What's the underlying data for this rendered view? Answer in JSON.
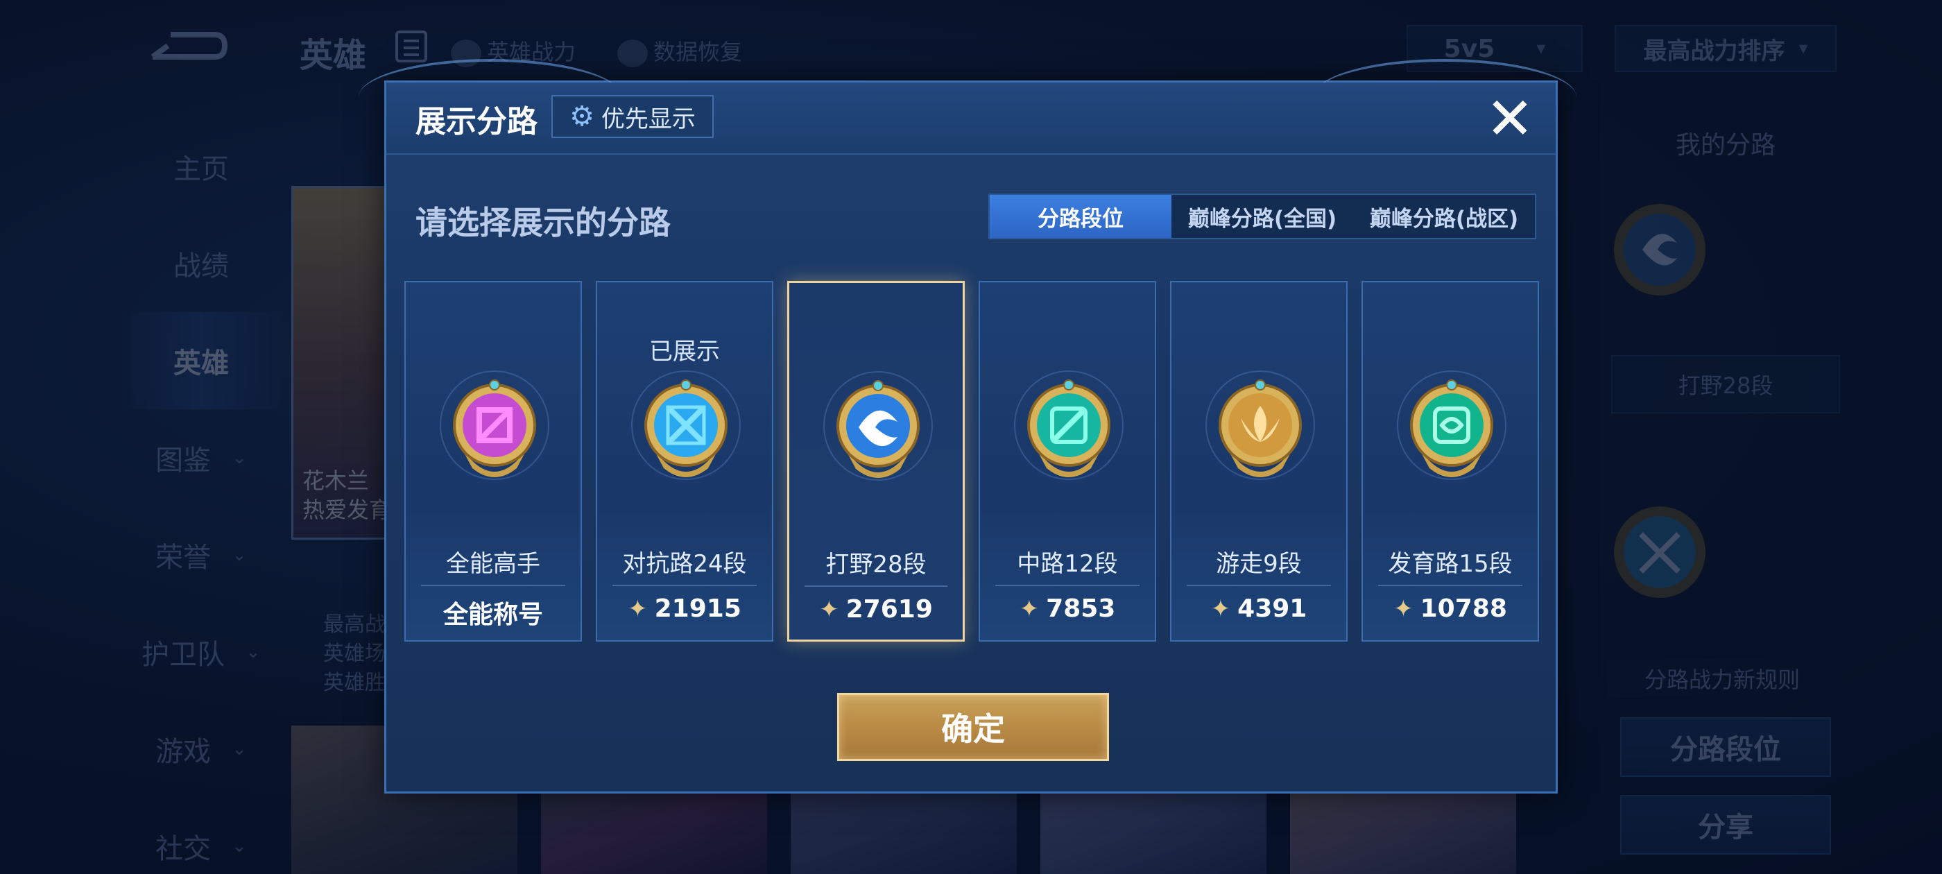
{
  "background": {
    "title": "英雄",
    "links": [
      "英雄战力",
      "数据恢复"
    ],
    "mode_select": "5v5",
    "sort_select": "最高战力排序",
    "sidebar": [
      {
        "label": "主页",
        "active": false,
        "chevron": false
      },
      {
        "label": "战绩",
        "active": false,
        "chevron": false
      },
      {
        "label": "英雄",
        "active": true,
        "chevron": false
      },
      {
        "label": "图鉴",
        "active": false,
        "chevron": true
      },
      {
        "label": "荣誉",
        "active": false,
        "chevron": true
      },
      {
        "label": "护卫队",
        "active": false,
        "chevron": true
      },
      {
        "label": "游戏",
        "active": false,
        "chevron": true
      },
      {
        "label": "社交",
        "active": false,
        "chevron": true
      }
    ],
    "hero_card_text": [
      "花木兰",
      "热爱发育"
    ],
    "hero_stats": [
      "最高战",
      "英雄场",
      "英雄胜"
    ],
    "right_panel": {
      "title": "我的分路",
      "lane_label": "打野28段",
      "rule_text": "分路战力新规则",
      "lane_button": "分路段位",
      "share_button": "分享"
    }
  },
  "modal": {
    "title": "展示分路",
    "priority_button": "优先显示",
    "subtitle": "请选择展示的分路",
    "tabs": [
      {
        "label": "分路段位",
        "active": true
      },
      {
        "label": "巅峰分路(全国)",
        "active": false
      },
      {
        "label": "巅峰分路(战区)",
        "active": false
      }
    ],
    "cards": [
      {
        "id": "all",
        "name": "全能高手",
        "value": "全能称号",
        "show_power_icon": false,
        "shown_text": "",
        "selected": false,
        "color": "#c54bd0",
        "inner": "#ff8cff"
      },
      {
        "id": "top",
        "name": "对抗路24段",
        "value": "21915",
        "show_power_icon": true,
        "shown_text": "已展示",
        "selected": false,
        "color": "#2aa8f0",
        "inner": "#7fe2ff"
      },
      {
        "id": "jungle",
        "name": "打野28段",
        "value": "27619",
        "show_power_icon": true,
        "shown_text": "",
        "selected": true,
        "color": "#2b7fe0",
        "inner": "#ffffff"
      },
      {
        "id": "mid",
        "name": "中路12段",
        "value": "7853",
        "show_power_icon": true,
        "shown_text": "",
        "selected": false,
        "color": "#17b6a0",
        "inner": "#8affea"
      },
      {
        "id": "roam",
        "name": "游走9段",
        "value": "4391",
        "show_power_icon": true,
        "shown_text": "",
        "selected": false,
        "color": "#d19a3f",
        "inner": "#ffe0a0"
      },
      {
        "id": "adc",
        "name": "发育路15段",
        "value": "10788",
        "show_power_icon": true,
        "shown_text": "",
        "selected": false,
        "color": "#12b48e",
        "inner": "#a8ffe8"
      }
    ],
    "confirm_button": "确定"
  }
}
